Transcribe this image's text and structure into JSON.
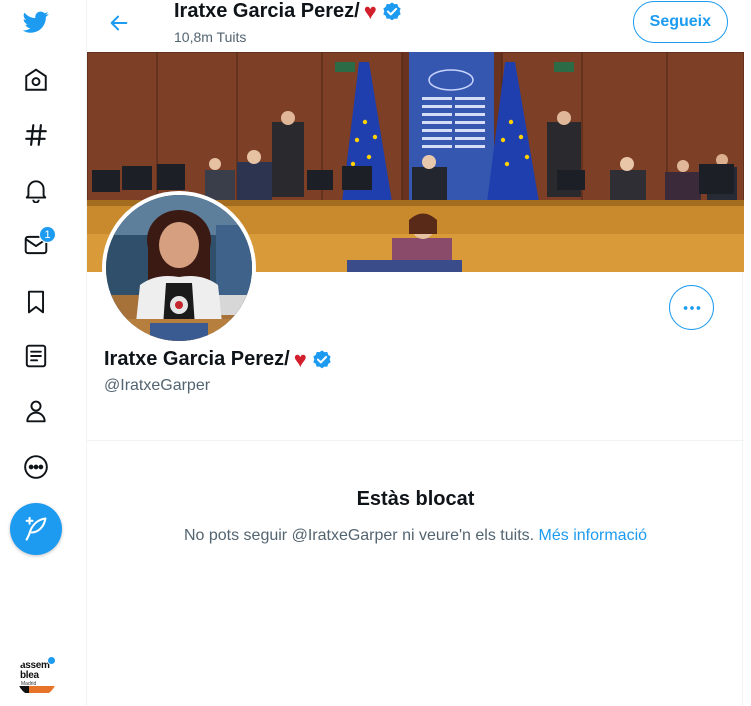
{
  "colors": {
    "accent": "#1d9bf0",
    "text": "#0f1419",
    "secondary": "#536471",
    "heart": "#d21f2b"
  },
  "nav": {
    "items": [
      {
        "icon": "twitter-logo-icon"
      },
      {
        "icon": "home-icon"
      },
      {
        "icon": "explore-hashtag-icon"
      },
      {
        "icon": "notifications-bell-icon"
      },
      {
        "icon": "messages-envelope-icon",
        "badge": "1"
      },
      {
        "icon": "bookmarks-icon"
      },
      {
        "icon": "lists-icon"
      },
      {
        "icon": "profile-icon"
      },
      {
        "icon": "more-circle-icon"
      }
    ],
    "compose_icon": "compose-feather-icon",
    "account": {
      "logo_text_line1": "assem",
      "logo_text_line2": "blea",
      "logo_sub": "Madrid"
    }
  },
  "header": {
    "name": "Iratxe Garcia Perez/",
    "heart": "♥",
    "tweet_count": "10,8m Tuits",
    "follow_label": "Segueix"
  },
  "profile": {
    "name": "Iratxe Garcia Perez/",
    "heart": "♥",
    "handle": "@IratxeGarper"
  },
  "blocked": {
    "title": "Estàs blocat",
    "message": "No pots seguir @IratxeGarper ni veure'n els tuits.",
    "link": "Més informació"
  }
}
